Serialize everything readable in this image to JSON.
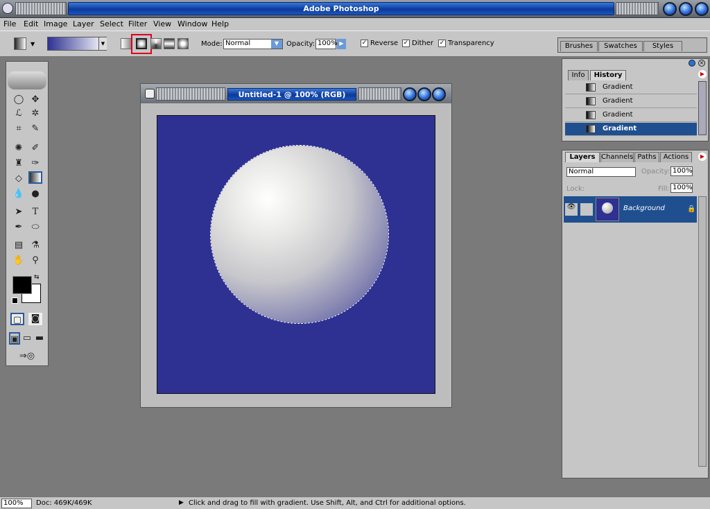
{
  "app": {
    "title": "Adobe Photoshop"
  },
  "menu": [
    "File",
    "Edit",
    "Image",
    "Layer",
    "Select",
    "Filter",
    "View",
    "Window",
    "Help"
  ],
  "options": {
    "mode_label": "Mode:",
    "mode_value": "Normal",
    "opacity_label": "Opacity:",
    "opacity_value": "100%",
    "reverse_label": "Reverse",
    "dither_label": "Dither",
    "transparency_label": "Transparency",
    "gradient_types": [
      "linear",
      "radial",
      "angle",
      "reflected",
      "diamond"
    ],
    "selected_type": "radial"
  },
  "brush_tabs": [
    "Brushes",
    "Swatches",
    "Styles"
  ],
  "document": {
    "title": "Untitled-1 @ 100% (RGB)",
    "canvas_color": "#2e3192"
  },
  "history_panel": {
    "tabs": [
      "Info",
      "History"
    ],
    "items": [
      "Gradient",
      "Gradient",
      "Gradient",
      "Gradient"
    ]
  },
  "layers_panel": {
    "tabs": [
      "Layers",
      "Channels",
      "Paths",
      "Actions"
    ],
    "blend_mode": "Normal",
    "opacity_label": "Opacity:",
    "opacity_value": "100%",
    "lock_label": "Lock:",
    "fill_label": "Fill:",
    "fill_value": "100%",
    "layer_name": "Background"
  },
  "status": {
    "zoom": "100%",
    "doc": "Doc: 469K/469K",
    "hint": "Click and drag to fill with gradient. Use Shift, Alt, and Ctrl for additional options."
  },
  "colors": {
    "accent": "#1f4f8f",
    "highlight": "#e0001a"
  }
}
